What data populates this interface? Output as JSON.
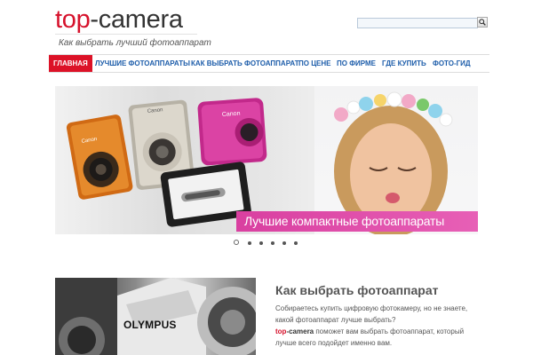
{
  "logo": {
    "part1": "top",
    "part2": "-camera"
  },
  "tagline": "Как выбрать лучший фотоаппарат",
  "search": {
    "value": "",
    "placeholder": ""
  },
  "nav": [
    {
      "label": "Главная",
      "active": true
    },
    {
      "label": "Лучшие фотоаппараты"
    },
    {
      "label": "Как выбрать фотоаппарат"
    },
    {
      "label": "По цене"
    },
    {
      "label": "По фирме"
    },
    {
      "label": "Где купить"
    },
    {
      "label": "Фото-гид"
    }
  ],
  "slider": {
    "banner": "Лучшие компактные фотоаппараты",
    "camera_brand": "Canon",
    "slide_count": 6,
    "active_slide": 1
  },
  "section": {
    "image_label": "OLYMPUS",
    "title": "Как выбрать  фотоаппарат",
    "line1": "Собираетесь купить цифровую фотокамеру, но не знаете, какой фотоаппарат лучше выбрать?",
    "brand1": "top",
    "brand2": "-camera",
    "line2": " поможет вам выбрать фотоаппарат, который лучше всего подойдет именно вам."
  },
  "colors": {
    "accent": "#d6112b",
    "nav_text": "#1d5daa",
    "banner": "#d93fa0"
  }
}
